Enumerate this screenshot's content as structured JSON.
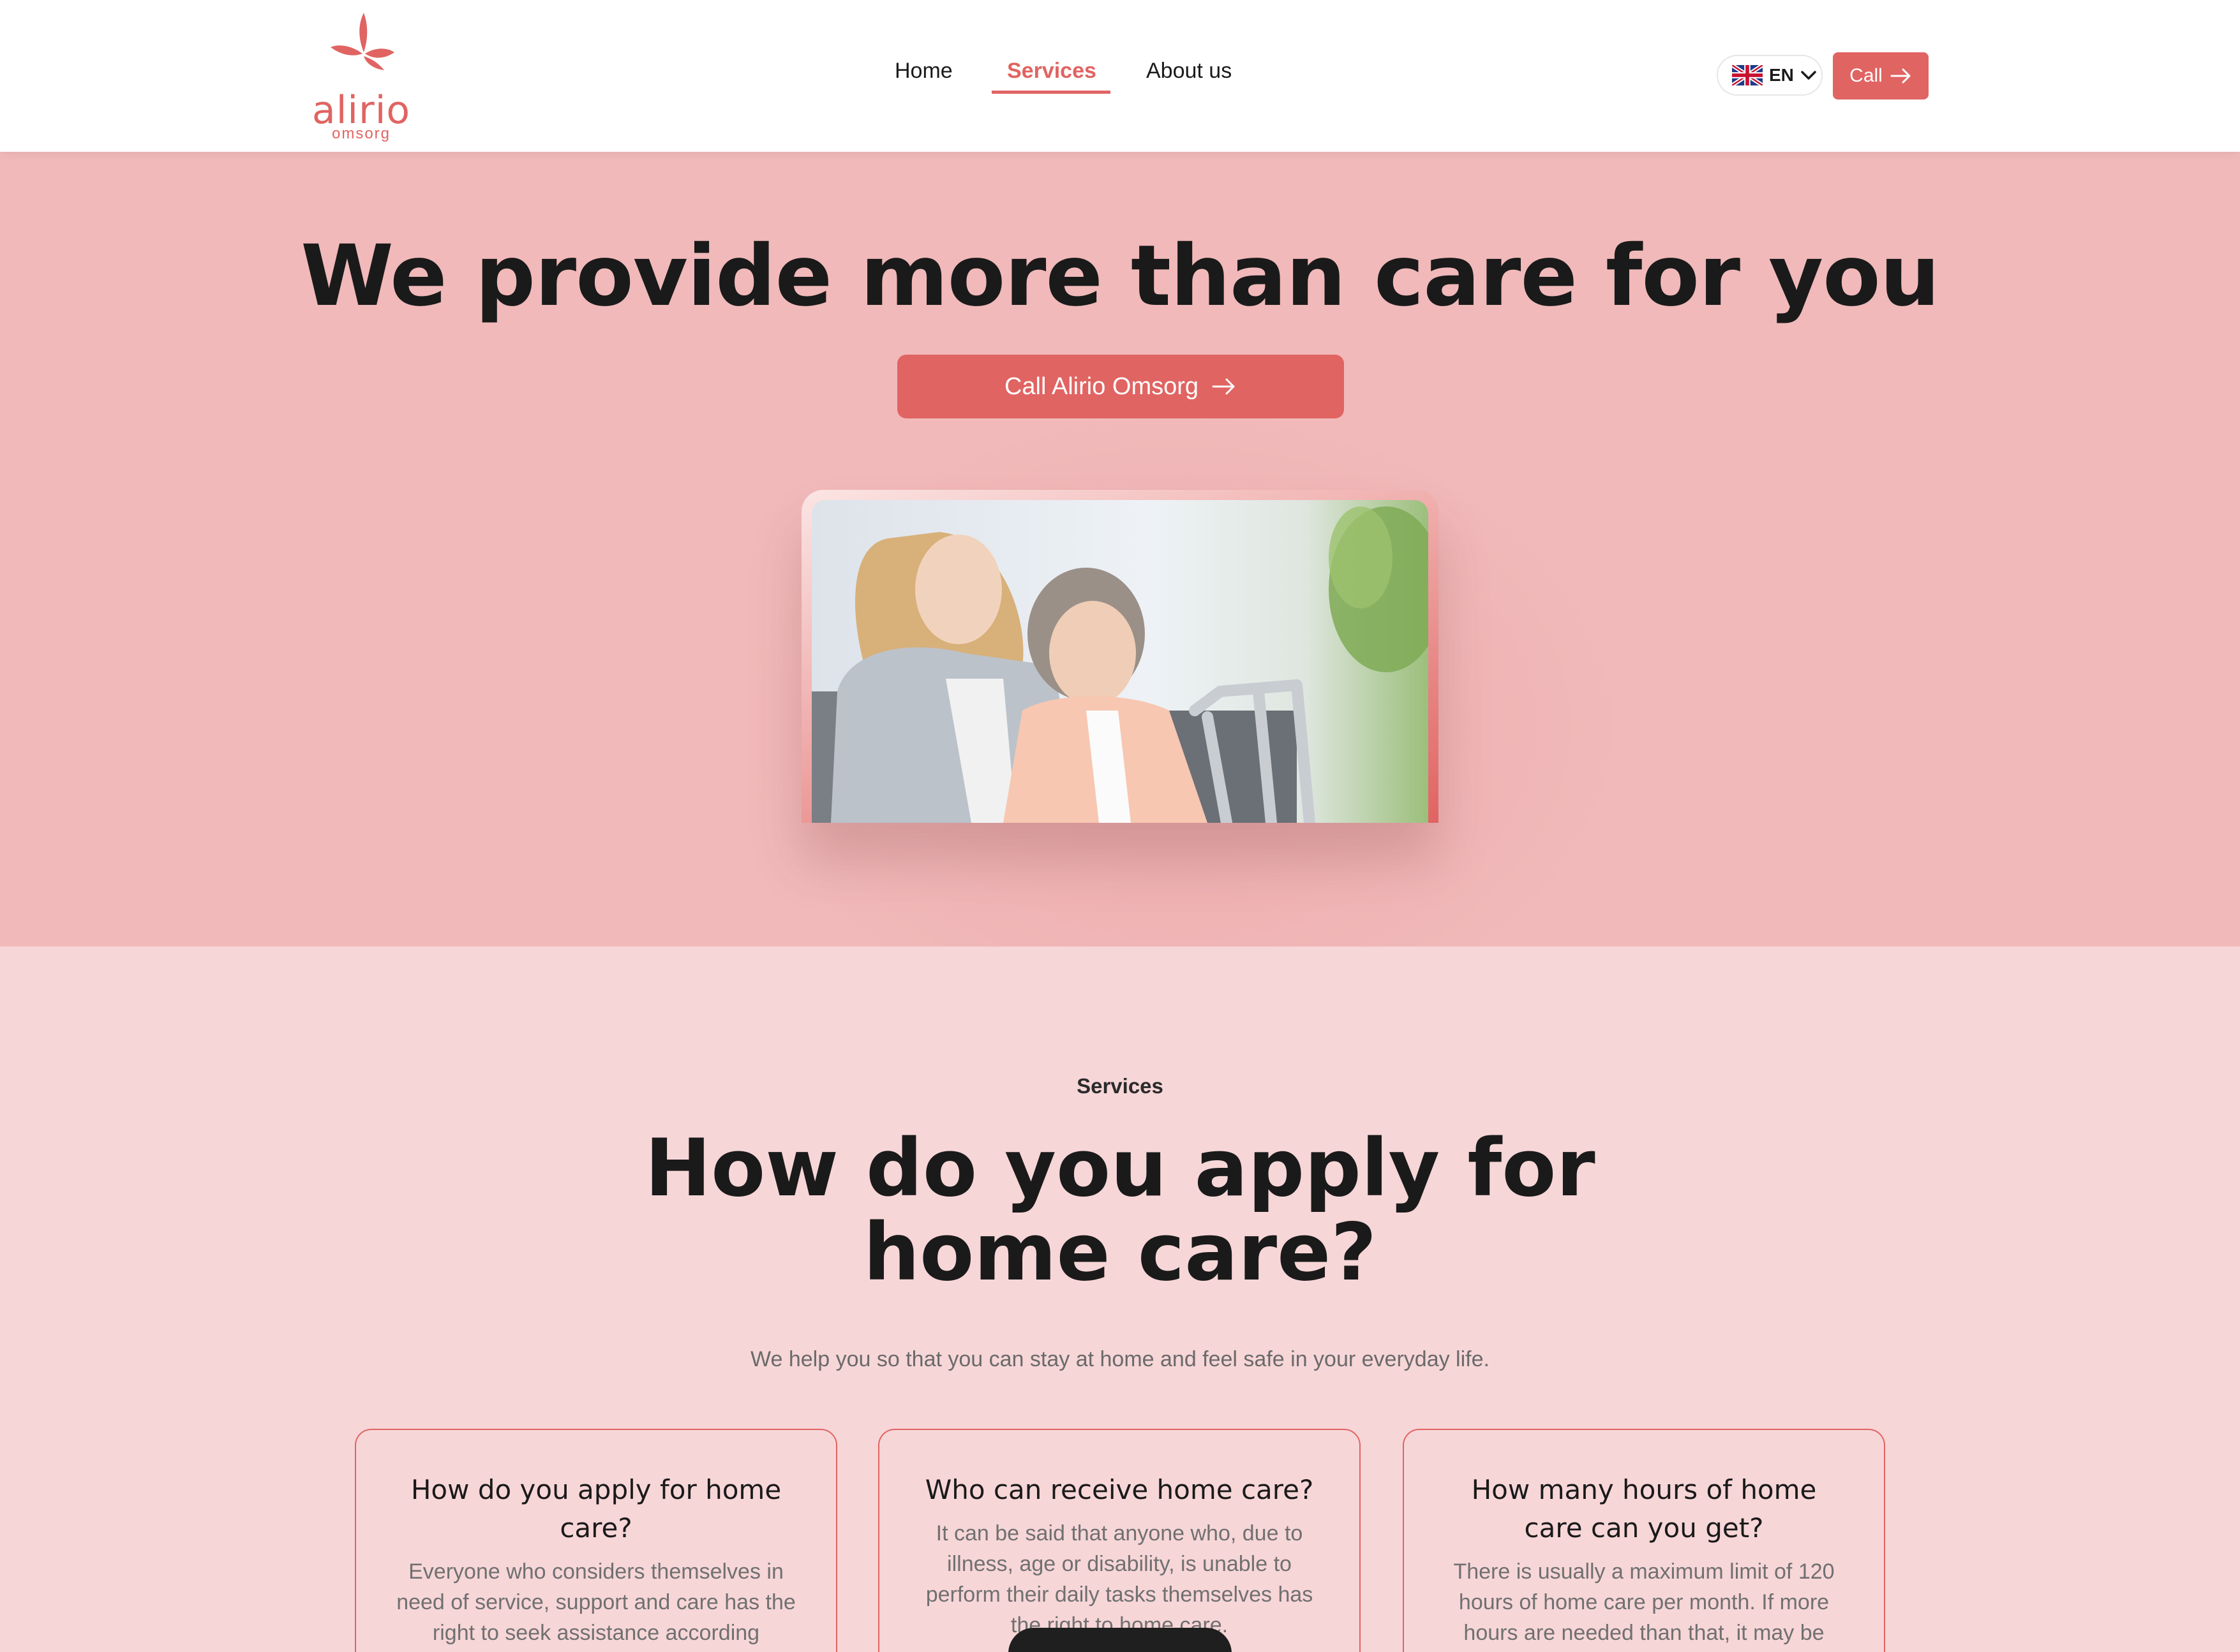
{
  "brand": {
    "name": "alirio",
    "sub": "omsorg",
    "color": "#e06462"
  },
  "nav": {
    "items": [
      {
        "label": "Home"
      },
      {
        "label": "Services",
        "active": true
      },
      {
        "label": "About us"
      }
    ]
  },
  "header": {
    "language": "EN",
    "language_icon": "uk-flag-icon",
    "call_label": "Call"
  },
  "hero": {
    "title": "We provide more than care for you",
    "button_label": "Call Alirio Omsorg",
    "background": "#f1b9ba"
  },
  "services": {
    "eyebrow": "Services",
    "title_line1": "How do you apply for",
    "title_line2": "home care?",
    "subtitle": "We help you so that you can stay at home and feel safe in your everyday life.",
    "background": "#f7d6d8",
    "cards": [
      {
        "title": "How do you apply for home care?",
        "text": "Everyone who considers themselves in need of service, support and care has the right to seek assistance according"
      },
      {
        "title": "Who can receive home care?",
        "text": "It can be said that anyone who, due to illness, age or disability, is unable to perform their daily tasks themselves has the right to home care."
      },
      {
        "title": "How many hours of home care can you get?",
        "text": "There is usually a maximum limit of 120 hours of home care per month. If more hours are needed than that, it may be"
      }
    ]
  }
}
